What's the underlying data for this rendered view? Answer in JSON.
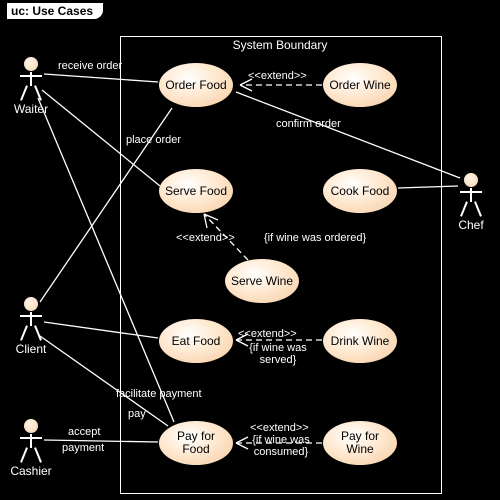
{
  "frame_label": "uc: Use Cases",
  "boundary_title": "System Boundary",
  "actors": {
    "waiter": "Waiter",
    "chef": "Chef",
    "client": "Client",
    "cashier": "Cashier"
  },
  "use_cases": {
    "order_food": "Order Food",
    "order_wine": "Order Wine",
    "serve_food": "Serve Food",
    "cook_food": "Cook Food",
    "serve_wine": "Serve Wine",
    "eat_food": "Eat Food",
    "drink_wine": "Drink Wine",
    "pay_food": "Pay for Food",
    "pay_wine": "Pay for Wine"
  },
  "labels": {
    "receive_order": "receive order",
    "place_order": "place order",
    "confirm_order": "confirm order",
    "extend1": "<<extend>>",
    "extend2": "<<extend>>",
    "extend3": "<<extend>>",
    "extend4": "<<extend>>",
    "guard_wine_ordered": "{if wine was ordered}",
    "guard_wine_served": "{if wine was served}",
    "guard_wine_consumed": "{if wine was consumed}",
    "facilitate_payment": "facilitate payment",
    "pay": "pay",
    "accept_payment_l1": "accept",
    "accept_payment_l2": "payment"
  },
  "chart_data": {
    "type": "uml-use-case",
    "actors": [
      "Waiter",
      "Chef",
      "Client",
      "Cashier"
    ],
    "use_cases": [
      "Order Food",
      "Order Wine",
      "Serve Food",
      "Cook Food",
      "Serve Wine",
      "Eat Food",
      "Drink Wine",
      "Pay for Food",
      "Pay for Wine"
    ],
    "associations": [
      {
        "actor": "Waiter",
        "use_case": "Order Food",
        "label": "receive order"
      },
      {
        "actor": "Waiter",
        "use_case": "Serve Food"
      },
      {
        "actor": "Waiter",
        "use_case": "Pay for Food",
        "label": "facilitate payment"
      },
      {
        "actor": "Client",
        "use_case": "Order Food",
        "label": "place order"
      },
      {
        "actor": "Client",
        "use_case": "Eat Food"
      },
      {
        "actor": "Client",
        "use_case": "Pay for Food",
        "label": "pay"
      },
      {
        "actor": "Chef",
        "use_case": "Order Food",
        "label": "confirm order"
      },
      {
        "actor": "Chef",
        "use_case": "Cook Food"
      },
      {
        "actor": "Cashier",
        "use_case": "Pay for Food",
        "label": "accept payment"
      }
    ],
    "extends": [
      {
        "extension": "Order Wine",
        "base": "Order Food"
      },
      {
        "extension": "Serve Wine",
        "base": "Serve Food",
        "guard": "if wine was ordered"
      },
      {
        "extension": "Drink Wine",
        "base": "Eat Food",
        "guard": "if wine was served"
      },
      {
        "extension": "Pay for Wine",
        "base": "Pay for Food",
        "guard": "if wine was consumed"
      }
    ]
  }
}
